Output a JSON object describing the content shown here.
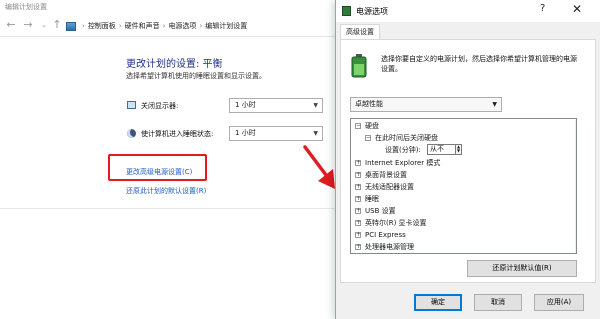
{
  "background_window": {
    "title": "编辑计划设置",
    "breadcrumbs": [
      "控制面板",
      "硬件和声音",
      "电源选项",
      "编辑计划设置"
    ],
    "heading": "更改计划的设置: 平衡",
    "subheading": "选择希望计算机使用的睡眠设置和显示设置。",
    "settings": [
      {
        "label": "关闭显示器:",
        "value": "1 小时"
      },
      {
        "label": "使计算机进入睡眠状态:",
        "value": "1 小时"
      }
    ],
    "links": {
      "advanced": "更改高级电源设置(C)",
      "restore": "还原此计划的默认设置(R)"
    }
  },
  "dialog": {
    "title": "电源选项",
    "help": "?",
    "close": "✕",
    "tab": "高级设置",
    "description": "选择你要自定义的电源计划，然后选择你希望计算机管理的电源设置。",
    "plan": "卓越性能",
    "tree": [
      {
        "label": "硬盘",
        "expanded": true,
        "level": 0
      },
      {
        "label": "在此时间后关闭硬盘",
        "expanded": true,
        "level": 1
      },
      {
        "label": "设置(分钟):",
        "value": "从不",
        "level": 2
      },
      {
        "label": "Internet Explorer 模式",
        "level": 0
      },
      {
        "label": "桌面背景设置",
        "level": 0
      },
      {
        "label": "无线适配器设置",
        "level": 0
      },
      {
        "label": "睡眠",
        "level": 0
      },
      {
        "label": "USB 设置",
        "level": 0
      },
      {
        "label": "英特尔(R) 显卡设置",
        "level": 0
      },
      {
        "label": "PCI Express",
        "level": 0
      },
      {
        "label": "处理器电源管理",
        "level": 0
      }
    ],
    "restore_button": "还原计划默认值(R)",
    "buttons": {
      "ok": "确定",
      "cancel": "取消",
      "apply": "应用(A)"
    }
  },
  "colors": {
    "highlight": "#e01b22",
    "link": "#1a5dc5",
    "heading": "#1e3287"
  }
}
